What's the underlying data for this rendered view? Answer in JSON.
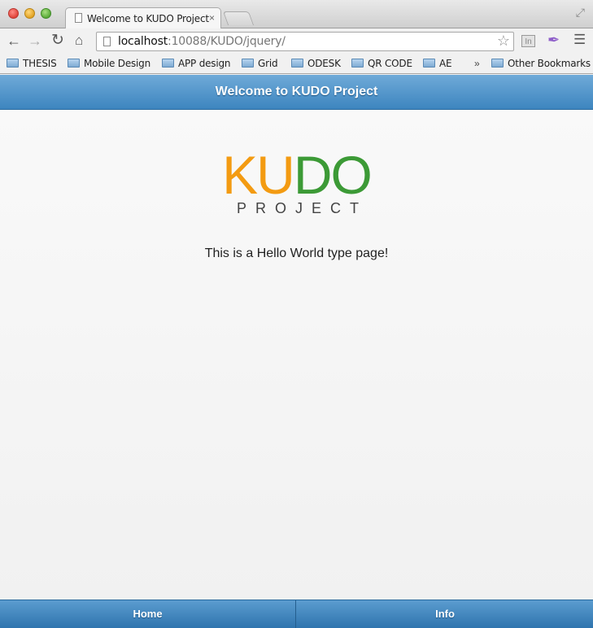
{
  "browser": {
    "tab_title": "Welcome to KUDO Project",
    "tab_close": "×",
    "url_host": "localhost",
    "url_rest": ":10088/KUDO/jquery/",
    "ext_label": "In",
    "bookmarks": [
      {
        "label": "THESIS"
      },
      {
        "label": "Mobile Design"
      },
      {
        "label": "APP design"
      },
      {
        "label": "Grid"
      },
      {
        "label": "ODESK"
      },
      {
        "label": "QR CODE"
      },
      {
        "label": "AE"
      }
    ],
    "overflow": "»",
    "other_bookmarks": "Other Bookmarks"
  },
  "header": {
    "title": "Welcome to KUDO Project"
  },
  "logo": {
    "ku": "KU",
    "do": "DO",
    "sub": "PROJECT"
  },
  "content": {
    "text": "This is a Hello World type page!"
  },
  "navbar": {
    "home": "Home",
    "info": "Info"
  },
  "colors": {
    "header_blue": "#4a90c8",
    "logo_orange": "#f39b12",
    "logo_green": "#3c9a36"
  }
}
